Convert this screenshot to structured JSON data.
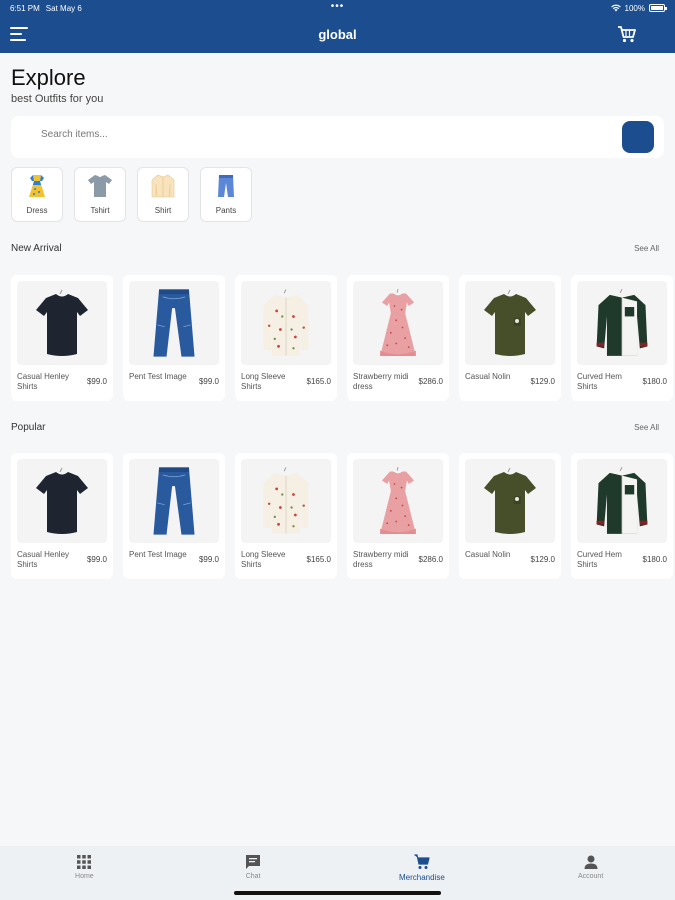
{
  "status_bar": {
    "time": "6:51 PM",
    "date": "Sat May 6",
    "battery": "100%"
  },
  "app_bar": {
    "title": "global"
  },
  "header": {
    "title": "Explore",
    "subtitle": "best Outfits for you"
  },
  "search": {
    "placeholder": "Search items..."
  },
  "categories": [
    {
      "label": "Dress",
      "icon": "dress-icon"
    },
    {
      "label": "Tshirt",
      "icon": "tshirt-icon"
    },
    {
      "label": "Shirt",
      "icon": "shirt-icon"
    },
    {
      "label": "Pants",
      "icon": "pants-icon"
    }
  ],
  "sections": {
    "new_arrival": {
      "title": "New Arrival",
      "see_all": "See All",
      "products": [
        {
          "name": "Casual Henley Shirts",
          "price": "$99.0",
          "image": "navy-tshirt"
        },
        {
          "name": "Pent Test Image",
          "price": "$99.0",
          "image": "blue-jeans"
        },
        {
          "name": "Long Sleeve Shirts",
          "price": "$165.0",
          "image": "floral-shirt"
        },
        {
          "name": "Strawberry midi dress",
          "price": "$286.0",
          "image": "pink-dress"
        },
        {
          "name": "Casual Nolin",
          "price": "$129.0",
          "image": "olive-tshirt"
        },
        {
          "name": "Curved Hem Shirts",
          "price": "$180.0",
          "image": "green-white-shirt"
        }
      ]
    },
    "popular": {
      "title": "Popular",
      "see_all": "See All",
      "products": [
        {
          "name": "Casual Henley Shirts",
          "price": "$99.0",
          "image": "navy-tshirt"
        },
        {
          "name": "Pent Test Image",
          "price": "$99.0",
          "image": "blue-jeans"
        },
        {
          "name": "Long Sleeve Shirts",
          "price": "$165.0",
          "image": "floral-shirt"
        },
        {
          "name": "Strawberry midi dress",
          "price": "$286.0",
          "image": "pink-dress"
        },
        {
          "name": "Casual Nolin",
          "price": "$129.0",
          "image": "olive-tshirt"
        },
        {
          "name": "Curved Hem Shirts",
          "price": "$180.0",
          "image": "green-white-shirt"
        }
      ]
    }
  },
  "bottom_nav": [
    {
      "label": "Home",
      "icon": "grid-icon",
      "active": false
    },
    {
      "label": "Chat",
      "icon": "chat-icon",
      "active": false
    },
    {
      "label": "Merchandise",
      "icon": "cart-icon",
      "active": true
    },
    {
      "label": "Account",
      "icon": "person-icon",
      "active": false
    }
  ],
  "colors": {
    "primary": "#1c4e8f",
    "background": "#f6f7f9",
    "card": "#ffffff"
  }
}
